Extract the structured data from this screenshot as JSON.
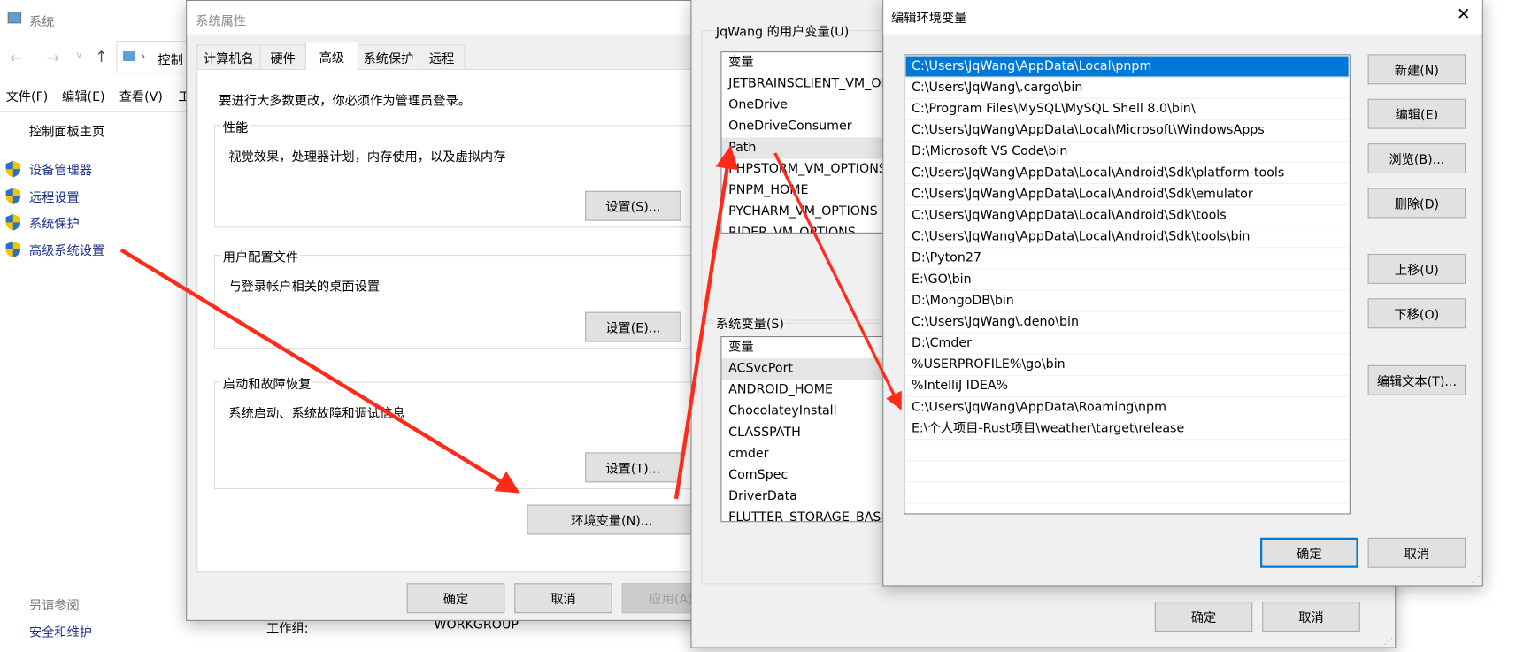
{
  "system_window": {
    "title": "系统",
    "breadcrumb": "控制",
    "menu": [
      "文件(F)",
      "编辑(E)",
      "查看(V)",
      "工"
    ],
    "home": "控制面板主页",
    "links": [
      "设备管理器",
      "远程设置",
      "系统保护",
      "高级系统设置"
    ],
    "see_also": "另请参阅",
    "security": "安全和维护",
    "workgroup_label": "工作组:",
    "workgroup_value": "WORKGROUP"
  },
  "sysprops": {
    "title": "系统属性",
    "tabs": [
      "计算机名",
      "硬件",
      "高级",
      "系统保护",
      "远程"
    ],
    "active_tab": "高级",
    "admin_note": "要进行大多数更改，你必须作为管理员登录。",
    "groups": [
      {
        "label": "性能",
        "desc": "视觉效果，处理器计划，内存使用，以及虚拟内存",
        "button": "设置(S)..."
      },
      {
        "label": "用户配置文件",
        "desc": "与登录帐户相关的桌面设置",
        "button": "设置(E)..."
      },
      {
        "label": "启动和故障恢复",
        "desc": "系统启动、系统故障和调试信息",
        "button": "设置(T)..."
      }
    ],
    "env_button": "环境变量(N)...",
    "ok": "确定",
    "cancel": "取消",
    "apply": "应用(A)"
  },
  "envvars": {
    "user_group": "JqWang 的用户变量(U)",
    "column": "变量",
    "user_vars": [
      "JETBRAINSCLIENT_VM_OPTIONS",
      "OneDrive",
      "OneDriveConsumer",
      "Path",
      "PHPSTORM_VM_OPTIONS",
      "PNPM_HOME",
      "PYCHARM_VM_OPTIONS",
      "RIDER_VM_OPTIONS"
    ],
    "user_selected": "Path",
    "system_group": "系统变量(S)",
    "system_vars": [
      "ACSvcPort",
      "ANDROID_HOME",
      "ChocolateyInstall",
      "CLASSPATH",
      "cmder",
      "ComSpec",
      "DriverData",
      "FLUTTER_STORAGE_BASE_URL"
    ],
    "system_selected": "ACSvcPort",
    "ok": "确定",
    "cancel": "取消"
  },
  "edit_env": {
    "title": "编辑环境变量",
    "close": "✕",
    "paths": [
      "C:\\Users\\JqWang\\AppData\\Local\\pnpm",
      "C:\\Users\\JqWang\\.cargo\\bin",
      "C:\\Program Files\\MySQL\\MySQL Shell 8.0\\bin\\",
      "C:\\Users\\JqWang\\AppData\\Local\\Microsoft\\WindowsApps",
      "D:\\Microsoft VS Code\\bin",
      "C:\\Users\\JqWang\\AppData\\Local\\Android\\Sdk\\platform-tools",
      "C:\\Users\\JqWang\\AppData\\Local\\Android\\Sdk\\emulator",
      "C:\\Users\\JqWang\\AppData\\Local\\Android\\Sdk\\tools",
      "C:\\Users\\JqWang\\AppData\\Local\\Android\\Sdk\\tools\\bin",
      "D:\\Pyton27",
      "E:\\GO\\bin",
      "D:\\MongoDB\\bin",
      "C:\\Users\\JqWang\\.deno\\bin",
      "D:\\Cmder",
      "%USERPROFILE%\\go\\bin",
      "%IntelliJ IDEA%",
      "C:\\Users\\JqWang\\AppData\\Roaming\\npm",
      "E:\\个人项目-Rust项目\\weather\\target\\release"
    ],
    "selected_index": 0,
    "buttons": {
      "new": "新建(N)",
      "edit": "编辑(E)",
      "browse": "浏览(B)...",
      "delete": "删除(D)",
      "up": "上移(U)",
      "down": "下移(O)",
      "edit_text": "编辑文本(T)..."
    },
    "ok": "确定",
    "cancel": "取消"
  },
  "colors": {
    "selection": "#0078d7",
    "annotation_arrow": "#ff2a1a",
    "link": "#1e3287"
  }
}
